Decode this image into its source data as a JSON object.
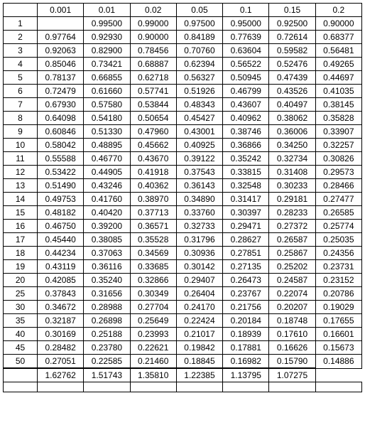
{
  "chart_data": {
    "type": "table",
    "title": "",
    "columns": [
      "0.001",
      "0.01",
      "0.02",
      "0.05",
      "0.1",
      "0.15",
      "0.2"
    ],
    "row_labels": [
      "1",
      "2",
      "3",
      "4",
      "5",
      "6",
      "7",
      "8",
      "9",
      "10",
      "11",
      "12",
      "13",
      "14",
      "15",
      "16",
      "17",
      "18",
      "19",
      "20",
      "25",
      "30",
      "35",
      "40",
      "45",
      "50"
    ],
    "rows": [
      [
        "",
        "0.99500",
        "0.99000",
        "0.97500",
        "0.95000",
        "0.92500",
        "0.90000"
      ],
      [
        "0.97764",
        "0.92930",
        "0.90000",
        "0.84189",
        "0.77639",
        "0.72614",
        "0.68377"
      ],
      [
        "0.92063",
        "0.82900",
        "0.78456",
        "0.70760",
        "0.63604",
        "0.59582",
        "0.56481"
      ],
      [
        "0.85046",
        "0.73421",
        "0.68887",
        "0.62394",
        "0.56522",
        "0.52476",
        "0.49265"
      ],
      [
        "0.78137",
        "0.66855",
        "0.62718",
        "0.56327",
        "0.50945",
        "0.47439",
        "0.44697"
      ],
      [
        "0.72479",
        "0.61660",
        "0.57741",
        "0.51926",
        "0.46799",
        "0.43526",
        "0.41035"
      ],
      [
        "0.67930",
        "0.57580",
        "0.53844",
        "0.48343",
        "0.43607",
        "0.40497",
        "0.38145"
      ],
      [
        "0.64098",
        "0.54180",
        "0.50654",
        "0.45427",
        "0.40962",
        "0.38062",
        "0.35828"
      ],
      [
        "0.60846",
        "0.51330",
        "0.47960",
        "0.43001",
        "0.38746",
        "0.36006",
        "0.33907"
      ],
      [
        "0.58042",
        "0.48895",
        "0.45662",
        "0.40925",
        "0.36866",
        "0.34250",
        "0.32257"
      ],
      [
        "0.55588",
        "0.46770",
        "0.43670",
        "0.39122",
        "0.35242",
        "0.32734",
        "0.30826"
      ],
      [
        "0.53422",
        "0.44905",
        "0.41918",
        "0.37543",
        "0.33815",
        "0.31408",
        "0.29573"
      ],
      [
        "0.51490",
        "0.43246",
        "0.40362",
        "0.36143",
        "0.32548",
        "0.30233",
        "0.28466"
      ],
      [
        "0.49753",
        "0.41760",
        "0.38970",
        "0.34890",
        "0.31417",
        "0.29181",
        "0.27477"
      ],
      [
        "0.48182",
        "0.40420",
        "0.37713",
        "0.33760",
        "0.30397",
        "0.28233",
        "0.26585"
      ],
      [
        "0.46750",
        "0.39200",
        "0.36571",
        "0.32733",
        "0.29471",
        "0.27372",
        "0.25774"
      ],
      [
        "0.45440",
        "0.38085",
        "0.35528",
        "0.31796",
        "0.28627",
        "0.26587",
        "0.25035"
      ],
      [
        "0.44234",
        "0.37063",
        "0.34569",
        "0.30936",
        "0.27851",
        "0.25867",
        "0.24356"
      ],
      [
        "0.43119",
        "0.36116",
        "0.33685",
        "0.30142",
        "0.27135",
        "0.25202",
        "0.23731"
      ],
      [
        "0.42085",
        "0.35240",
        "0.32866",
        "0.29407",
        "0.26473",
        "0.24587",
        "0.23152"
      ],
      [
        "0.37843",
        "0.31656",
        "0.30349",
        "0.26404",
        "0.23767",
        "0.22074",
        "0.20786"
      ],
      [
        "0.34672",
        "0.28988",
        "0.27704",
        "0.24170",
        "0.21756",
        "0.20207",
        "0.19029"
      ],
      [
        "0.32187",
        "0.26898",
        "0.25649",
        "0.22424",
        "0.20184",
        "0.18748",
        "0.17655"
      ],
      [
        "0.30169",
        "0.25188",
        "0.23993",
        "0.21017",
        "0.18939",
        "0.17610",
        "0.16601"
      ],
      [
        "0.28482",
        "0.23780",
        "0.22621",
        "0.19842",
        "0.17881",
        "0.16626",
        "0.15673"
      ],
      [
        "0.27051",
        "0.22585",
        "0.21460",
        "0.18845",
        "0.16982",
        "0.15790",
        "0.14886"
      ]
    ],
    "summary_row": [
      "",
      "1.62762",
      "1.51743",
      "1.35810",
      "1.22385",
      "1.13795",
      "1.07275"
    ]
  },
  "corner_label": ""
}
